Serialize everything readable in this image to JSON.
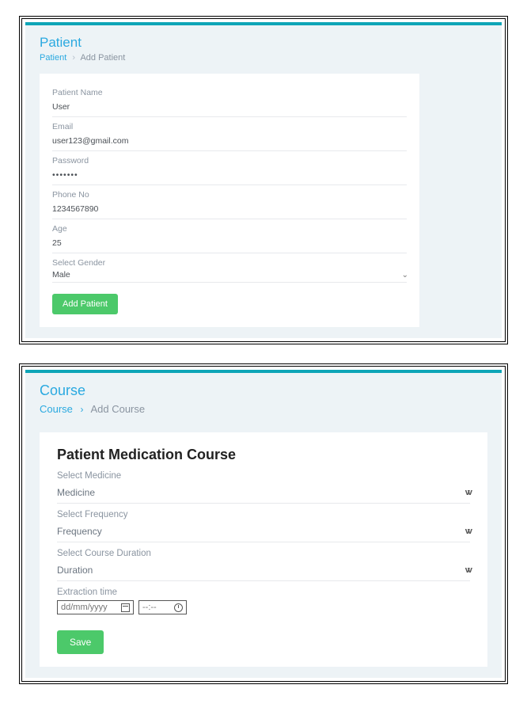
{
  "patient_panel": {
    "title": "Patient",
    "breadcrumb": {
      "root": "Patient",
      "current": "Add Patient"
    },
    "fields": {
      "name": {
        "label": "Patient Name",
        "value": "User"
      },
      "email": {
        "label": "Email",
        "value": "user123@gmail.com"
      },
      "password": {
        "label": "Password",
        "value": "•••••••"
      },
      "phone": {
        "label": "Phone No",
        "value": "1234567890"
      },
      "age": {
        "label": "Age",
        "value": "25"
      },
      "gender": {
        "label": "Select Gender",
        "selected": "Male"
      }
    },
    "submit_label": "Add Patient"
  },
  "course_panel": {
    "title": "Course",
    "breadcrumb": {
      "root": "Course",
      "current": "Add Course"
    },
    "heading": "Patient Medication Course",
    "fields": {
      "medicine": {
        "label": "Select Medicine",
        "placeholder": "Medicine"
      },
      "frequency": {
        "label": "Select Frequency",
        "placeholder": "Frequency"
      },
      "duration": {
        "label": "Select Course Duration",
        "placeholder": "Duration"
      },
      "extraction": {
        "label": "Extraction time",
        "date_placeholder": "dd/mm/yyyy",
        "time_placeholder": "--:--"
      }
    },
    "submit_label": "Save"
  }
}
